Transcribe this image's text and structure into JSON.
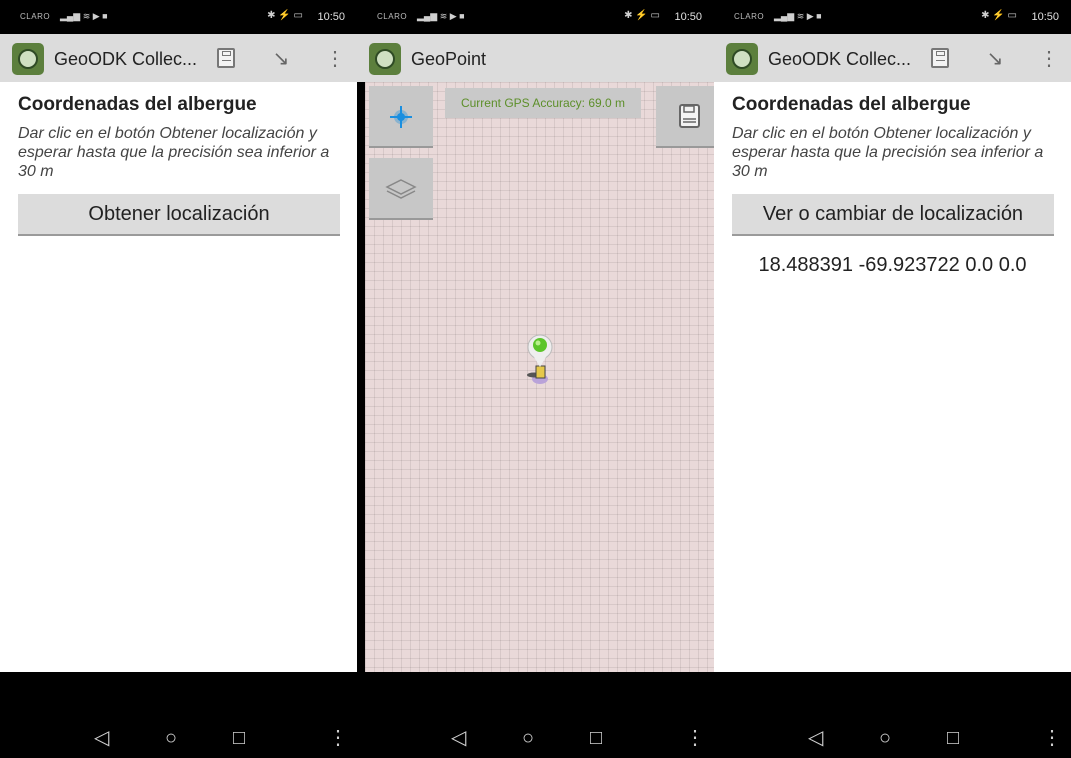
{
  "status_bar": {
    "carrier": "CLARO",
    "time": "10:50"
  },
  "panel_left": {
    "app_title": "GeoODK Collec...",
    "question_title": "Coordenadas del albergue",
    "question_hint": "Dar clic en el botón Obtener localización y esperar hasta que la precisión sea inferior a 30 m",
    "button_label": "Obtener localización"
  },
  "panel_middle": {
    "app_title": "GeoPoint",
    "gps_accuracy_text": "Current GPS Accuracy: 69.0 m"
  },
  "panel_right": {
    "app_title": "GeoODK Collec...",
    "question_title": "Coordenadas del albergue",
    "question_hint": "Dar clic en el botón Obtener localización y esperar hasta que la precisión sea inferior a 30 m",
    "button_label": "Ver o cambiar de localización",
    "coordinates": "18.488391 -69.923722 0.0 0.0"
  },
  "icons": {
    "app": "geoodk-app-icon",
    "save": "floppy-disk-icon",
    "goto": "goto-arrow-icon",
    "overflow": "overflow-menu-icon",
    "my_location": "crosshair-location-icon",
    "layers": "layers-icon",
    "marker": "map-pin-icon",
    "nav_back": "back-triangle-icon",
    "nav_home": "home-circle-icon",
    "nav_recent": "recent-square-icon"
  },
  "colors": {
    "appbar": "#dcdcdc",
    "map_background": "#e9d9d9",
    "gps_text": "#5d8f2a",
    "location_blue": "#1a8fe0",
    "marker_green": "#5cc52a"
  }
}
